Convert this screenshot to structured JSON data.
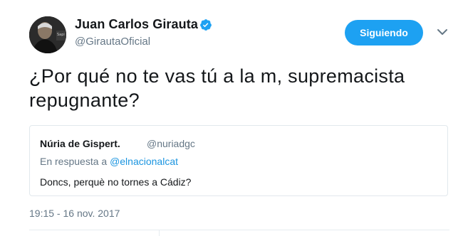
{
  "tweet": {
    "author": {
      "name": "Juan Carlos Girauta",
      "handle": "@GirautaOficial",
      "verified": true
    },
    "follow_button_label": "Siguiendo",
    "text": "¿Por qué no te vas tú a la m, supremacista repugnante?",
    "quoted": {
      "name": "Núria de Gispert.",
      "handle": "@nuriadgc",
      "reply_prefix": "En respuesta a ",
      "reply_to": "@elnacionalcat",
      "text": "Doncs, perquè no tornes a Cádiz?"
    },
    "timestamp": "19:15 - 16 nov. 2017"
  },
  "icons": {
    "verified": "verified-badge-icon",
    "caret": "chevron-down-icon"
  },
  "colors": {
    "accent": "#1da1f2",
    "mention": "#1b95e0",
    "secondary_text": "#657786",
    "border": "#e1e8ed"
  }
}
